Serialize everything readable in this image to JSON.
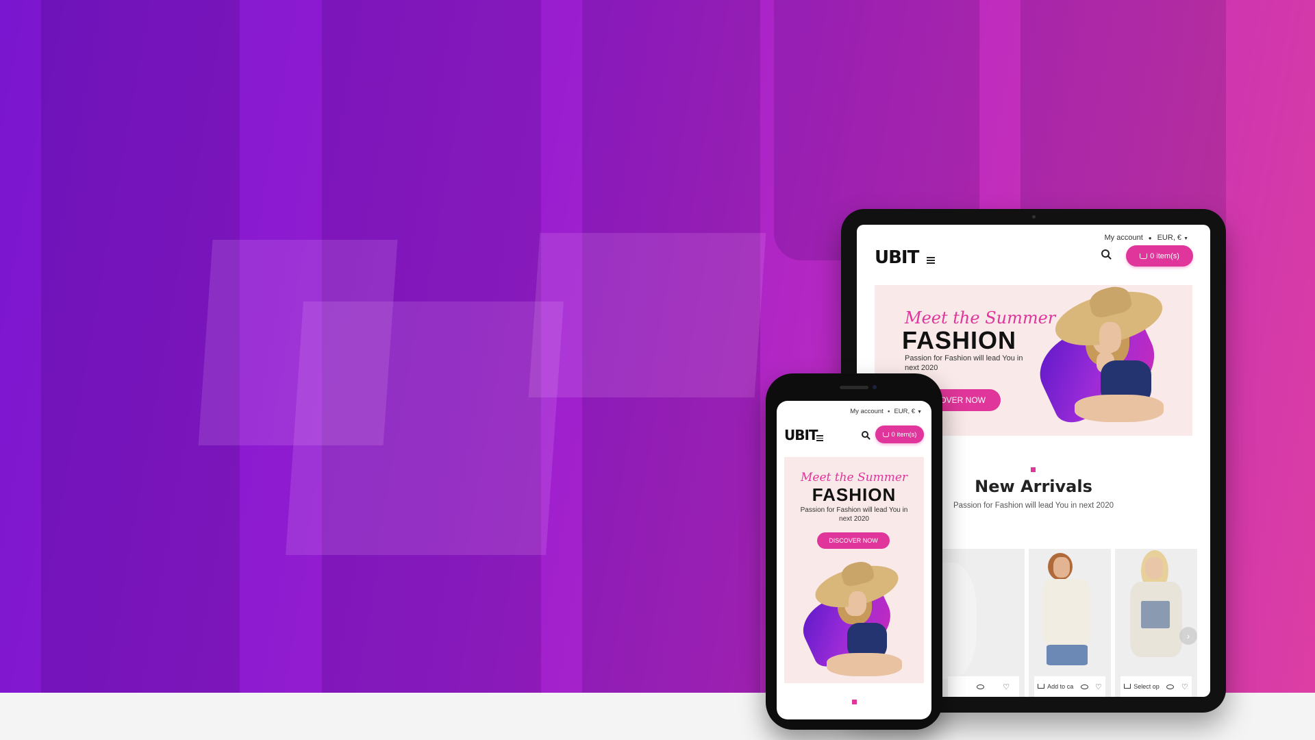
{
  "brand": {
    "logo": "UBIT",
    "accent": "#e0359a"
  },
  "topbar": {
    "account": "My account",
    "currency": "EUR, €"
  },
  "cart": {
    "label": "0 item(s)"
  },
  "banner": {
    "script": "Meet the Summer",
    "headline": "FASHION",
    "subtitle": "Passion for Fashion will lead You in next 2020",
    "cta": "DISCOVER NOW",
    "cta_tablet_visible": "OVER NOW"
  },
  "section": {
    "title": "New Arrivals",
    "subtitle": "Passion for Fashion will lead You in next 2020"
  },
  "products": [
    {
      "action": ""
    },
    {
      "action": "Add to ca"
    },
    {
      "action": "Select op"
    }
  ],
  "icons": [
    "hamburger-icon",
    "search-icon",
    "basket-icon",
    "cart-icon",
    "eye-icon",
    "heart-icon",
    "chevron-right-icon"
  ]
}
